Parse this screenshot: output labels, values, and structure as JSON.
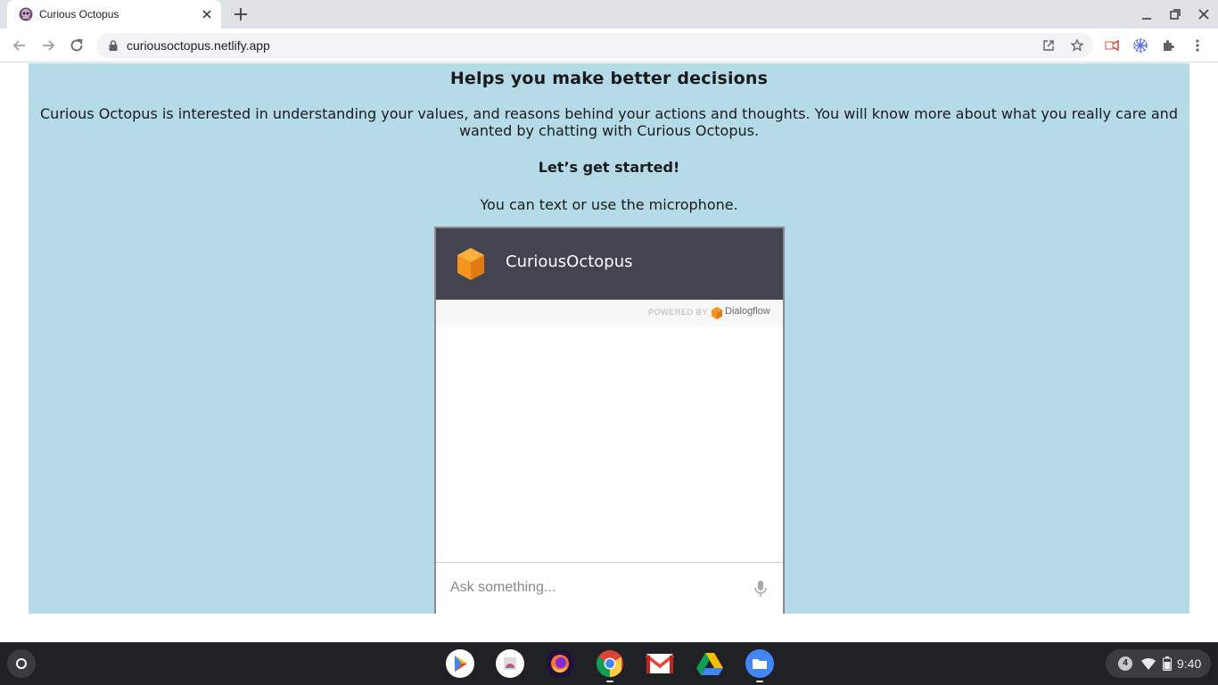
{
  "browser": {
    "tab_title": "Curious Octopus",
    "url": "curiousoctopus.netlify.app"
  },
  "page": {
    "heading": "Helps you make better decisions",
    "intro": "Curious Octopus is interested in understanding your values, and reasons behind your actions and thoughts. You will know more about what you really care and wanted by chatting with Curious Octopus.",
    "cta": "Let’s get started!",
    "hint": "You can text or use the microphone.",
    "background_color": "#b5dbe9"
  },
  "chat": {
    "bot_name": "CuriousOctopus",
    "powered_by": "POWERED BY",
    "provider": "Dialogflow",
    "input_placeholder": "Ask something...",
    "header_color": "#424550",
    "accent_color": "#f5941e"
  },
  "shelf": {
    "apps": [
      "play-store-icon",
      "files-app-icon",
      "firefox-icon",
      "chrome-icon",
      "gmail-icon",
      "drive-icon",
      "files-icon"
    ],
    "notification_count": "4",
    "time": "9:40"
  }
}
